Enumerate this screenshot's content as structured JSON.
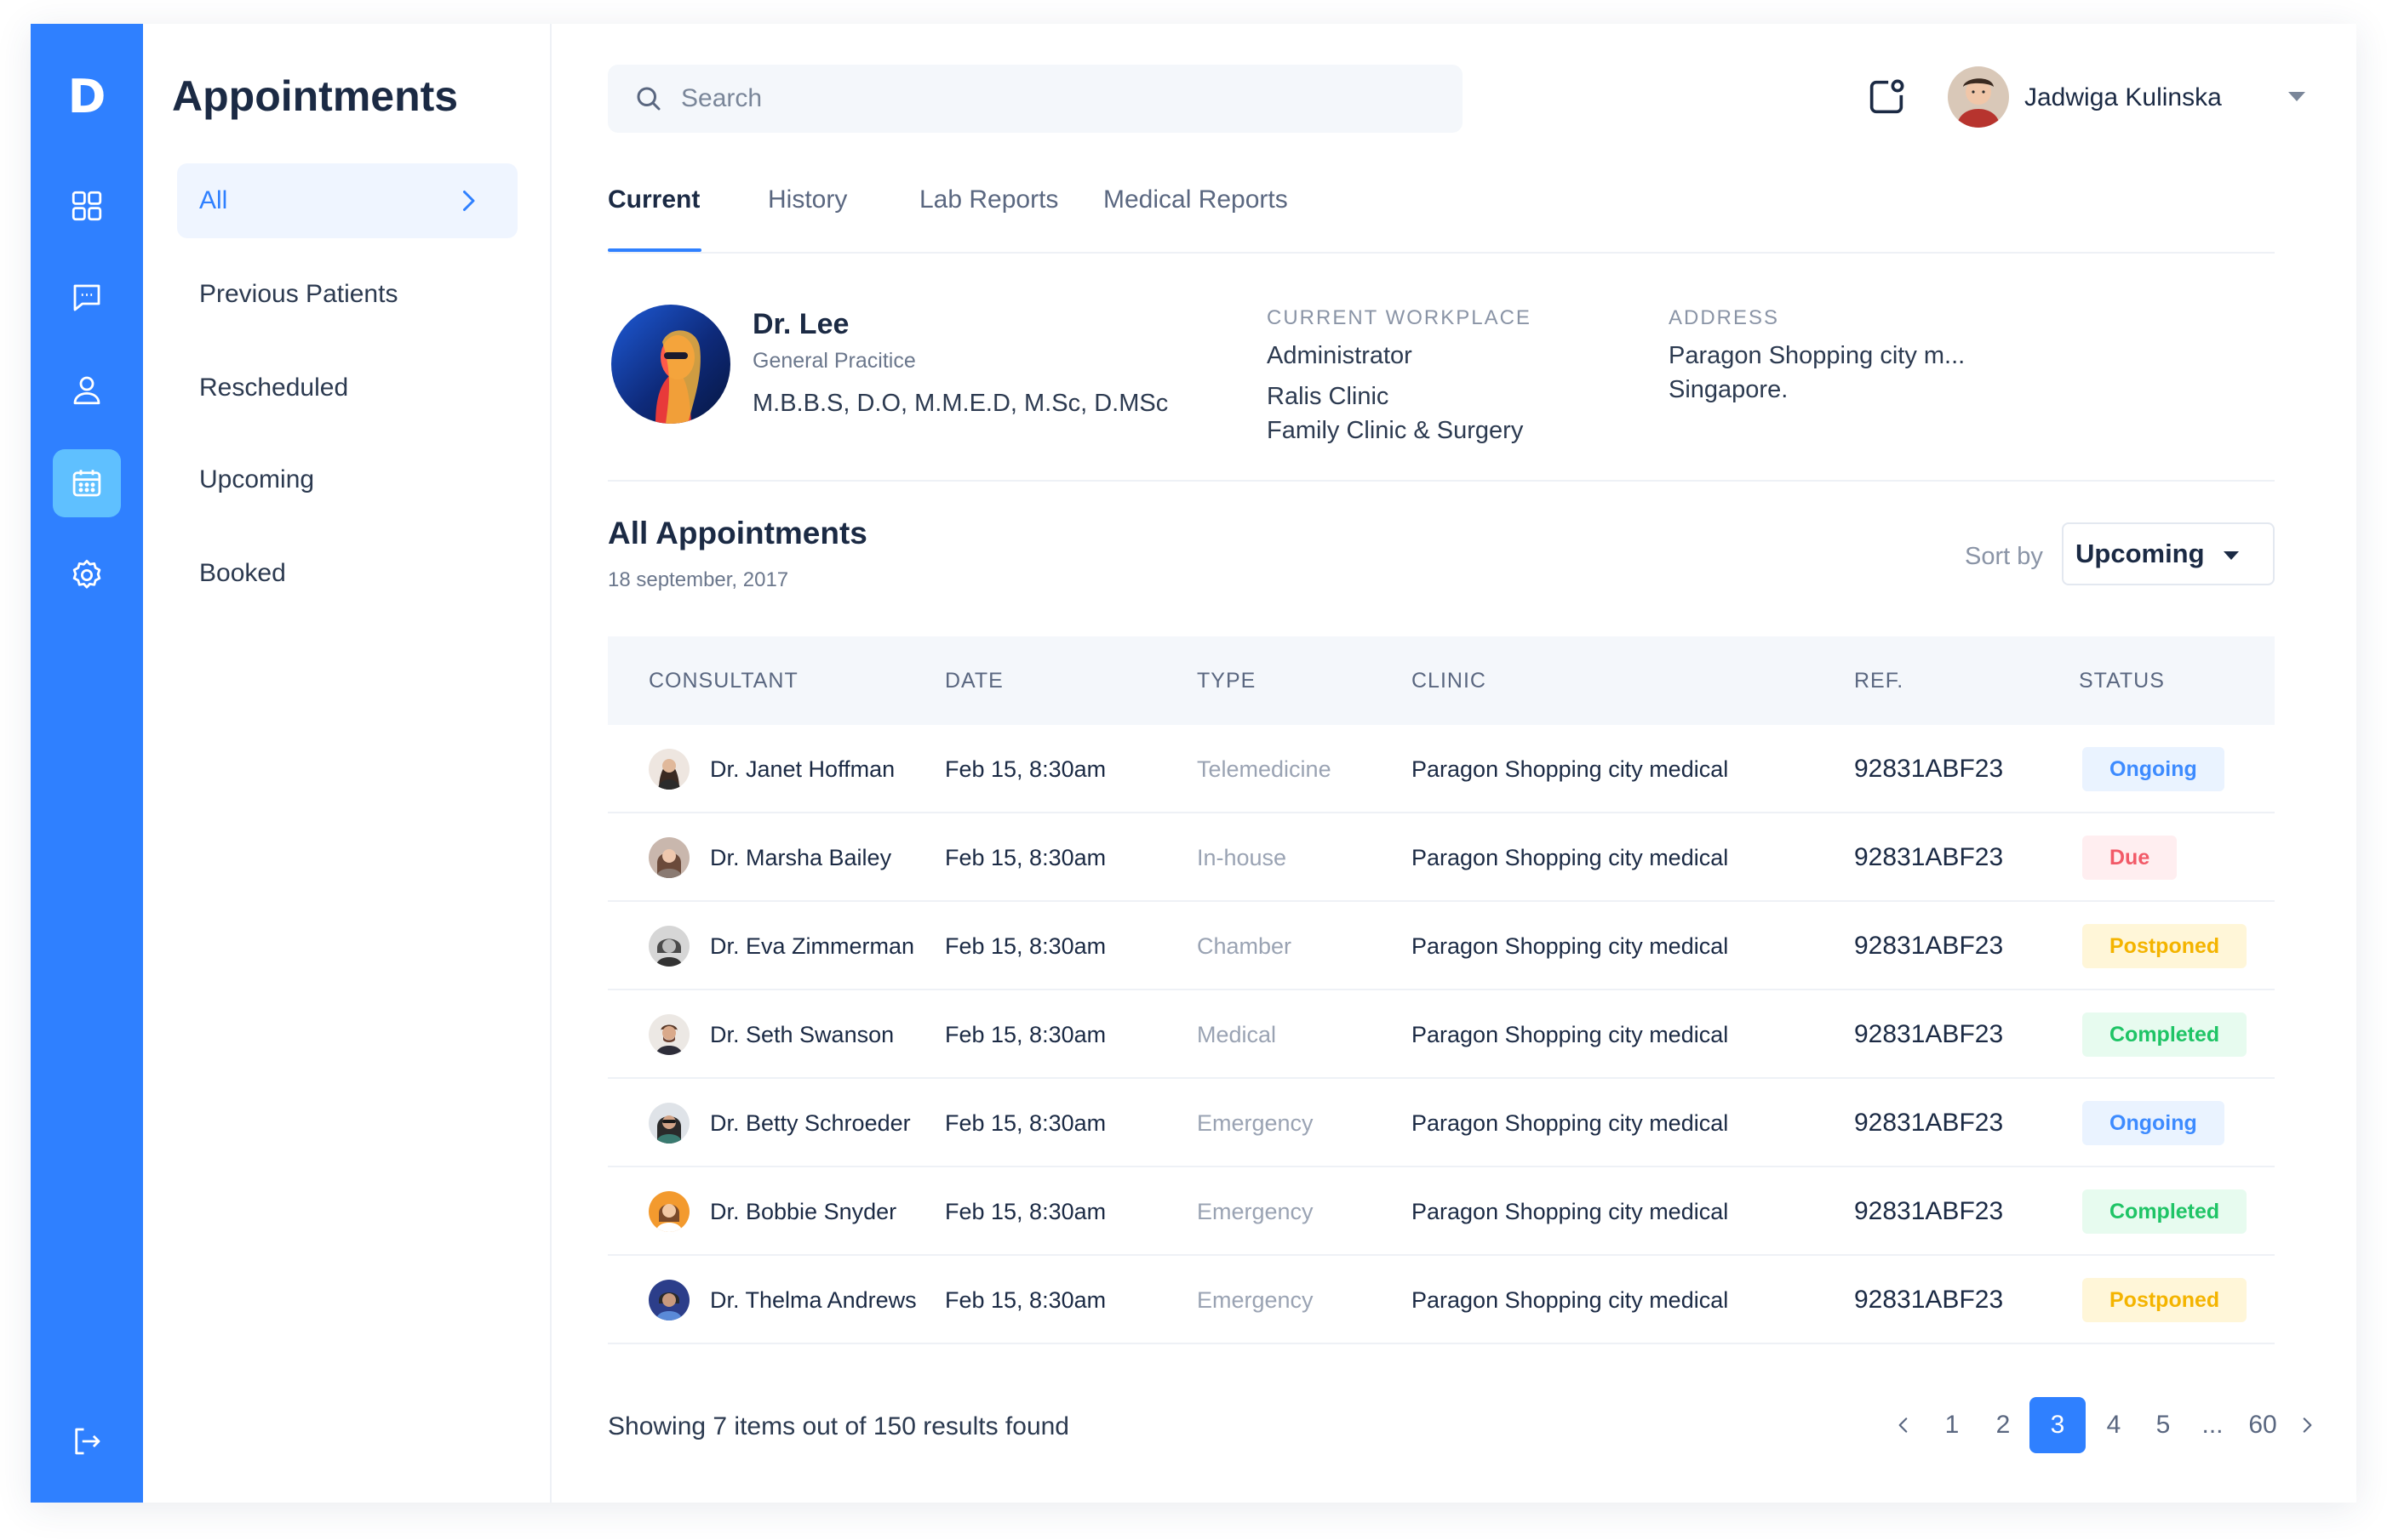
{
  "brand": {
    "logo": "D"
  },
  "rail": {
    "items": [
      {
        "name": "dashboard-icon"
      },
      {
        "name": "messages-icon"
      },
      {
        "name": "user-icon"
      },
      {
        "name": "calendar-icon",
        "active": true
      },
      {
        "name": "settings-icon"
      },
      {
        "name": "logout-icon"
      }
    ]
  },
  "sidebar": {
    "title": "Appointments",
    "items": [
      {
        "label": "All",
        "active": true
      },
      {
        "label": "Previous Patients"
      },
      {
        "label": "Rescheduled"
      },
      {
        "label": "Upcoming"
      },
      {
        "label": "Booked"
      }
    ]
  },
  "search": {
    "placeholder": "Search",
    "value": ""
  },
  "user": {
    "name": "Jadwiga Kulinska"
  },
  "tabs": [
    {
      "label": "Current",
      "active": true
    },
    {
      "label": "History"
    },
    {
      "label": "Lab Reports"
    },
    {
      "label": "Medical Reports"
    }
  ],
  "doctor": {
    "name": "Dr. Lee",
    "specialty": "General Pracitice",
    "degrees": "M.B.B.S, D.O, M.M.E.D, M.Sc, D.MSc",
    "workplace_label": "CURRENT WORKPLACE",
    "workplace_role": "Administrator",
    "workplace_line1": "Ralis Clinic",
    "workplace_line2": "Family Clinic & Surgery",
    "address_label": "ADDRESS",
    "address_line1": "Paragon Shopping city m...",
    "address_line2": "Singapore."
  },
  "appointments": {
    "title": "All Appointments",
    "date": "18 september, 2017",
    "sort_label": "Sort by",
    "sort_value": "Upcoming",
    "columns": [
      "CONSULTANT",
      "DATE",
      "TYPE",
      "CLINIC",
      "REF.",
      "STATUS"
    ],
    "rows": [
      {
        "consultant": "Dr. Janet Hoffman",
        "date": "Feb 15, 8:30am",
        "type": "Telemedicine",
        "clinic": "Paragon Shopping city medical",
        "ref": "92831ABF23",
        "status": "Ongoing"
      },
      {
        "consultant": "Dr. Marsha Bailey",
        "date": "Feb 15, 8:30am",
        "type": "In-house",
        "clinic": "Paragon Shopping city medical",
        "ref": "92831ABF23",
        "status": "Due"
      },
      {
        "consultant": "Dr. Eva Zimmerman",
        "date": "Feb 15, 8:30am",
        "type": "Chamber",
        "clinic": "Paragon Shopping city medical",
        "ref": "92831ABF23",
        "status": "Postponed"
      },
      {
        "consultant": "Dr. Seth Swanson",
        "date": "Feb 15, 8:30am",
        "type": "Medical",
        "clinic": "Paragon Shopping city medical",
        "ref": "92831ABF23",
        "status": "Completed"
      },
      {
        "consultant": "Dr. Betty Schroeder",
        "date": "Feb 15, 8:30am",
        "type": "Emergency",
        "clinic": "Paragon Shopping city medical",
        "ref": "92831ABF23",
        "status": "Ongoing"
      },
      {
        "consultant": "Dr. Bobbie Snyder",
        "date": "Feb 15, 8:30am",
        "type": "Emergency",
        "clinic": "Paragon Shopping city medical",
        "ref": "92831ABF23",
        "status": "Completed"
      },
      {
        "consultant": "Dr. Thelma Andrews",
        "date": "Feb 15, 8:30am",
        "type": "Emergency",
        "clinic": "Paragon Shopping city medical",
        "ref": "92831ABF23",
        "status": "Postponed"
      }
    ]
  },
  "status_colors": {
    "Ongoing": {
      "bg": "#eaf3ff",
      "fg": "#3d8bff"
    },
    "Due": {
      "bg": "#ffeef0",
      "fg": "#f25a68"
    },
    "Postponed": {
      "bg": "#fff6d8",
      "fg": "#f4b400"
    },
    "Completed": {
      "bg": "#e7fbef",
      "fg": "#1fc466"
    }
  },
  "pagination": {
    "summary": "Showing 7 items out of 150 results found",
    "pages": [
      "1",
      "2",
      "3",
      "4",
      "5",
      "...",
      "60"
    ],
    "current": "3"
  },
  "colors": {
    "accent": "#2f80ff",
    "rail_active": "#5fc0ff"
  }
}
